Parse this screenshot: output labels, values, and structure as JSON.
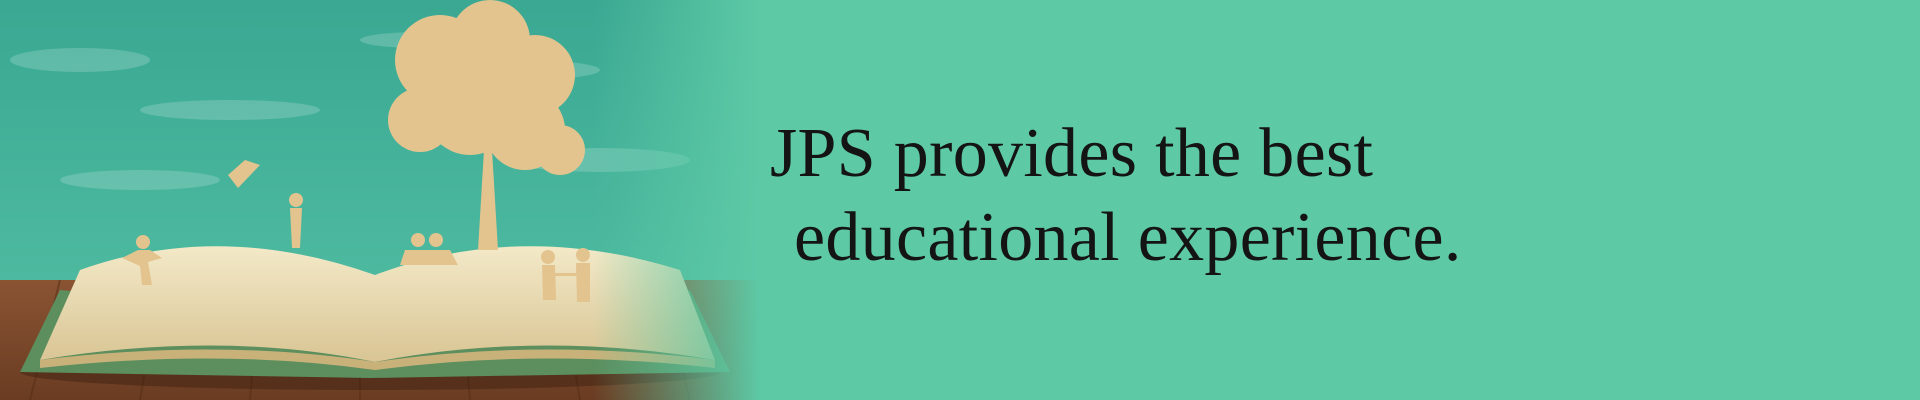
{
  "banner": {
    "headline_line1": "JPS provides the best",
    "headline_line2": "educational experience.",
    "colors": {
      "background": "#5dc9a5",
      "chalkboard": "#3fae96",
      "paper_cutout": "#e3c48f",
      "book_page": "#f1e6c4",
      "wood_table": "#7a4a2a",
      "text": "#141414"
    },
    "illustration": {
      "description_icon": "open-book-with-paper-cutout-tree-and-children-icon"
    }
  }
}
